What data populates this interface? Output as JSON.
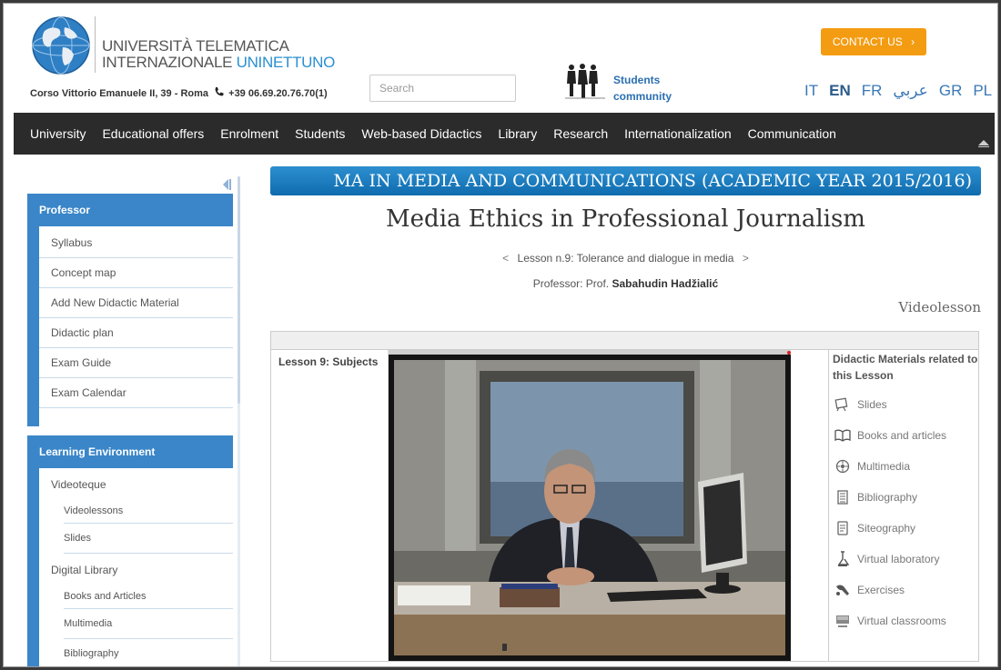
{
  "header": {
    "university_line1": "UNIVERSITÀ TELEMATICA",
    "university_line2_prefix": "INTERNAZIONALE ",
    "university_line2_brand": "UNINETTUNO",
    "address": "Corso Vittorio Emanuele II, 39 - Roma",
    "phone": "+39 06.69.20.76.70(1)",
    "search_placeholder": "Search",
    "community_line1": "Students",
    "community_line2": "community",
    "contact_label": "CONTACT US",
    "contact_chevron": "›",
    "languages": [
      "IT",
      "EN",
      "FR",
      "عربي",
      "GR",
      "PL"
    ],
    "active_language": "EN"
  },
  "nav": {
    "items": [
      "University",
      "Educational offers",
      "Enrolment",
      "Students",
      "Web-based Didactics",
      "Library",
      "Research",
      "Internationalization",
      "Communication"
    ]
  },
  "sidebar": {
    "professor": {
      "heading": "Professor",
      "items": [
        "Syllabus",
        "Concept map",
        "Add New Didactic Material",
        "Didactic plan",
        "Exam Guide",
        "Exam Calendar"
      ]
    },
    "learning": {
      "heading": "Learning Environment",
      "groups": [
        {
          "label": "Videoteque",
          "items": [
            "Videolessons",
            "Slides"
          ]
        },
        {
          "label": "Digital Library",
          "items": [
            "Books and Articles",
            "Multimedia",
            "Bibliography"
          ]
        }
      ]
    }
  },
  "main": {
    "banner": "MA IN MEDIA AND COMMUNICATIONS (ACADEMIC YEAR 2015/2016)",
    "course_title": "Media Ethics in Professional Journalism",
    "prev_arrow": "<",
    "lesson": "Lesson n.9: Tolerance and dialogue in media",
    "next_arrow": ">",
    "professor_prefix": "Professor: Prof.",
    "professor_name": "Sabahudin Hadžialić",
    "section_label": "Videolesson",
    "lesson_subjects": "Lesson 9: Subjects",
    "materials_title": "Didactic Materials related to this Lesson",
    "materials": [
      {
        "label": "Slides",
        "icon": "slides-icon"
      },
      {
        "label": "Books and articles",
        "icon": "book-icon"
      },
      {
        "label": "Multimedia",
        "icon": "multimedia-icon"
      },
      {
        "label": "Bibliography",
        "icon": "bibliography-icon"
      },
      {
        "label": "Siteography",
        "icon": "siteography-icon"
      },
      {
        "label": "Virtual laboratory",
        "icon": "lab-icon"
      },
      {
        "label": "Exercises",
        "icon": "exercises-icon"
      },
      {
        "label": "Virtual classrooms",
        "icon": "classroom-icon"
      }
    ]
  },
  "colors": {
    "accent_blue": "#3a86c8",
    "nav_bg": "#2b2b2b",
    "contact_orange": "#f39c12",
    "brand_blue": "#2a8fd1"
  }
}
